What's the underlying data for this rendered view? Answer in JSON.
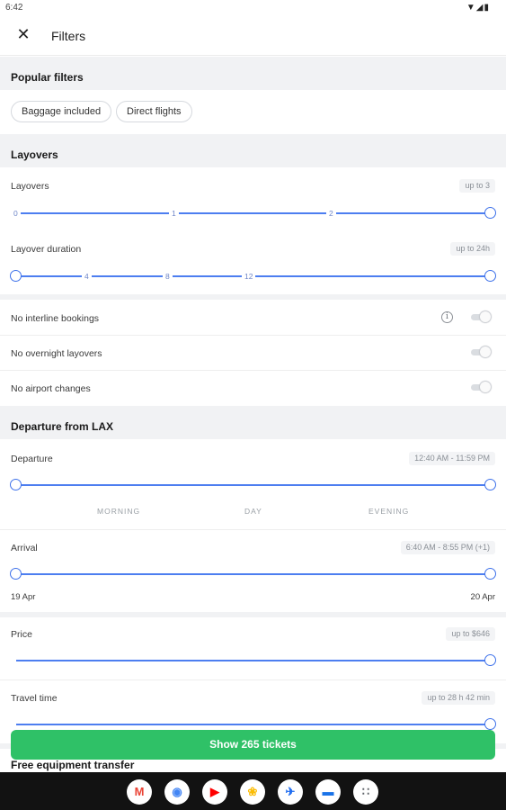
{
  "status_bar": {
    "time": "6:42",
    "icons": "▼◢▮"
  },
  "header": {
    "close_icon": "✕",
    "title": "Filters"
  },
  "popular": {
    "heading": "Popular filters",
    "chips": [
      "Baggage included",
      "Direct flights"
    ]
  },
  "layovers_section": {
    "heading": "Layovers",
    "layovers": {
      "label": "Layovers",
      "badge": "up to 3",
      "ticks": [
        "0",
        "1",
        "2"
      ],
      "range": [
        0,
        3
      ]
    },
    "duration": {
      "label": "Layover duration",
      "badge": "up to 24h",
      "ticks": [
        "4",
        "8",
        "12"
      ],
      "range": [
        0,
        24
      ]
    }
  },
  "toggles": [
    {
      "label": "No interline bookings",
      "on": false,
      "info_icon": "i"
    },
    {
      "label": "No overnight layovers",
      "on": false
    },
    {
      "label": "No airport changes",
      "on": false
    }
  ],
  "departure_section": {
    "heading": "Departure from LAX",
    "departure": {
      "label": "Departure",
      "badge": "12:40 AM - 11:59 PM"
    },
    "dayparts": [
      "MORNING",
      "DAY",
      "EVENING"
    ],
    "arrival": {
      "label": "Arrival",
      "badge": "6:40 AM - 8:55 PM (+1)",
      "start_date": "19 Apr",
      "end_date": "20 Apr"
    }
  },
  "price": {
    "label": "Price",
    "badge": "up to $646"
  },
  "travel_time": {
    "label": "Travel time",
    "badge": "up to 28 h 42 min"
  },
  "equipment": {
    "heading": "Free equipment transfer"
  },
  "cta": {
    "label": "Show 265 tickets",
    "color": "#2fc167"
  },
  "dock": [
    {
      "name": "gmail-icon",
      "glyph": "M",
      "color": "#ea4335"
    },
    {
      "name": "chrome-icon",
      "glyph": "◉",
      "color": "#4285f4"
    },
    {
      "name": "youtube-icon",
      "glyph": "▶",
      "color": "#ff0000"
    },
    {
      "name": "photos-icon",
      "glyph": "❀",
      "color": "#fbbc04"
    },
    {
      "name": "aviasales-icon",
      "glyph": "✈",
      "color": "#1f6cf0"
    },
    {
      "name": "messages-icon",
      "glyph": "▬",
      "color": "#1a73e8"
    },
    {
      "name": "app-drawer-icon",
      "glyph": "∷",
      "color": "#ffffff"
    }
  ]
}
